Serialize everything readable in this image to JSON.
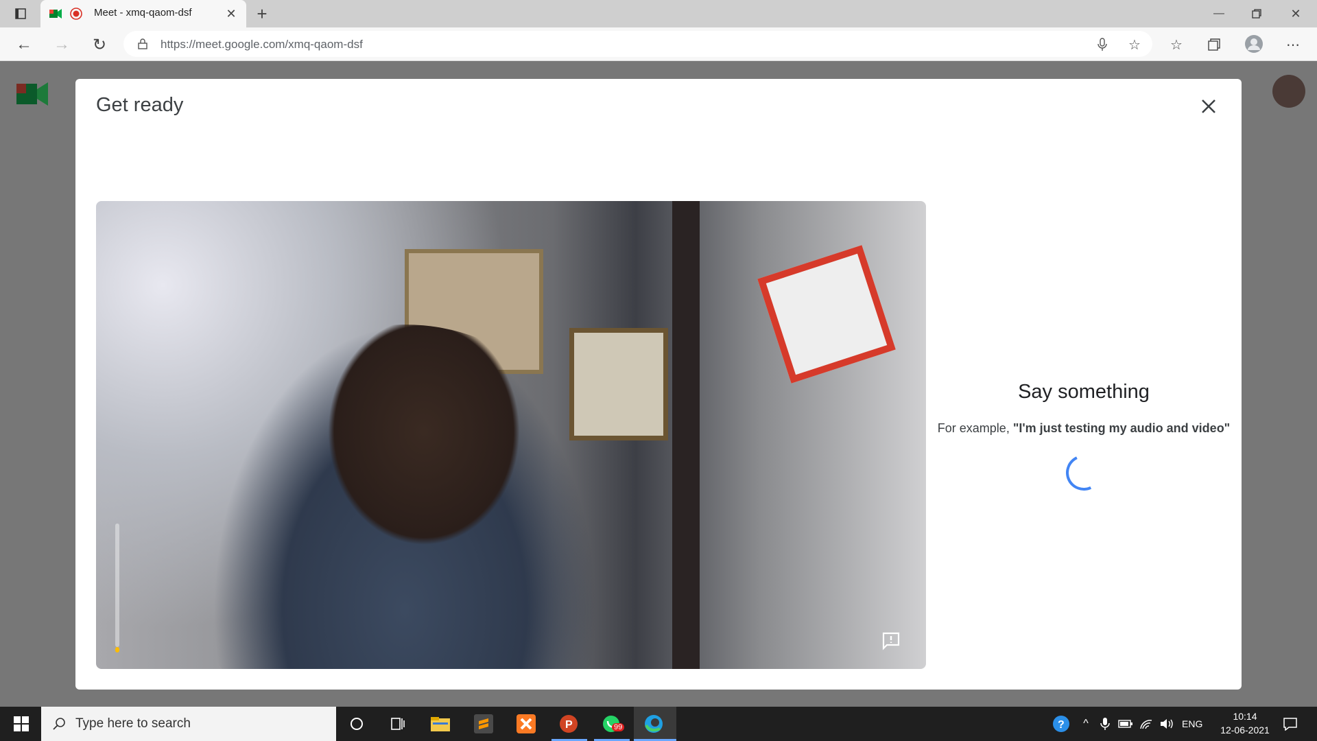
{
  "browser": {
    "tab_title": "Meet - xmq-qaom-dsf",
    "url": "https://meet.google.com/xmq-qaom-dsf"
  },
  "modal": {
    "title": "Get ready",
    "say_something": "Say something",
    "example_prefix": "For example, ",
    "example_quote": "\"I'm just testing my audio and video\""
  },
  "taskbar": {
    "search_placeholder": "Type here to search",
    "language": "ENG",
    "time": "10:14",
    "date": "12-06-2021",
    "whatsapp_badge": "99"
  }
}
